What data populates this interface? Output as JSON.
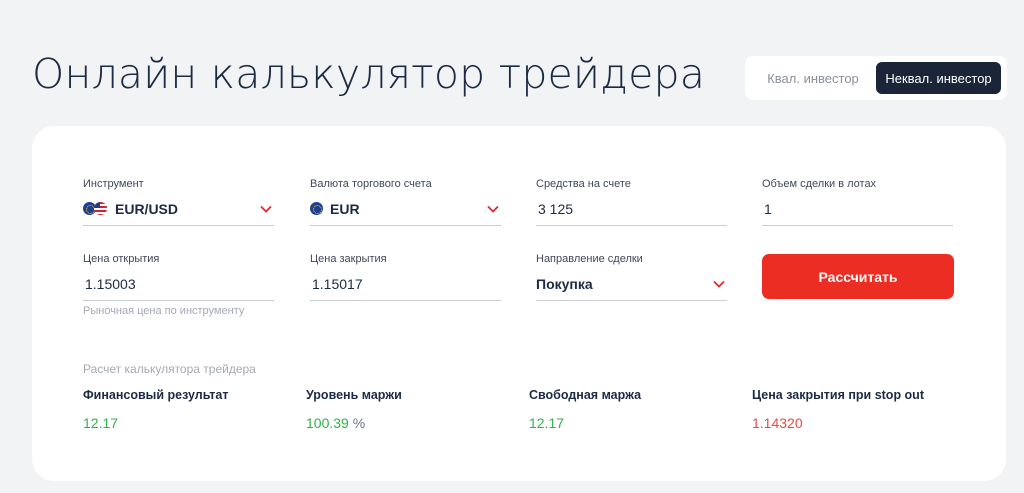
{
  "page": {
    "title": "Онлайн калькулятор трейдера"
  },
  "investor_toggle": {
    "options": [
      "Квал. инвестор",
      "Неквал. инвестор"
    ],
    "selected": "Неквал. инвестор"
  },
  "form": {
    "instrument": {
      "label": "Инструмент",
      "value": "EUR/USD",
      "icons": [
        "eu-flag-icon",
        "us-flag-icon"
      ]
    },
    "account_currency": {
      "label": "Валюта торгового счета",
      "value": "EUR",
      "icons": [
        "eu-flag-icon"
      ]
    },
    "funds": {
      "label": "Средства на счете",
      "value": "3 125"
    },
    "lot_volume": {
      "label": "Объем сделки в лотах",
      "value": "1"
    },
    "open_price": {
      "label": "Цена открытия",
      "value": "1.15003",
      "hint": "Рыночная цена по инструменту"
    },
    "close_price": {
      "label": "Цена закрытия",
      "value": "1.15017"
    },
    "direction": {
      "label": "Направление сделки",
      "value": "Покупка"
    },
    "calculate_label": "Рассчитать"
  },
  "results": {
    "header": "Расчет калькулятора трейдера",
    "financial_result": {
      "label": "Финансовый результат",
      "value": "12.17"
    },
    "margin_level": {
      "label": "Уровень маржи",
      "value": "100.39",
      "unit": "%"
    },
    "free_margin": {
      "label": "Свободная маржа",
      "value": "12.17"
    },
    "stop_out_price": {
      "label": "Цена закрытия при stop out",
      "value": "1.14320"
    }
  },
  "colors": {
    "accent_red": "#ec2d24",
    "positive_green": "#2fb24b",
    "negative_red": "#ea4a44",
    "dark_navy": "#1a2638"
  }
}
